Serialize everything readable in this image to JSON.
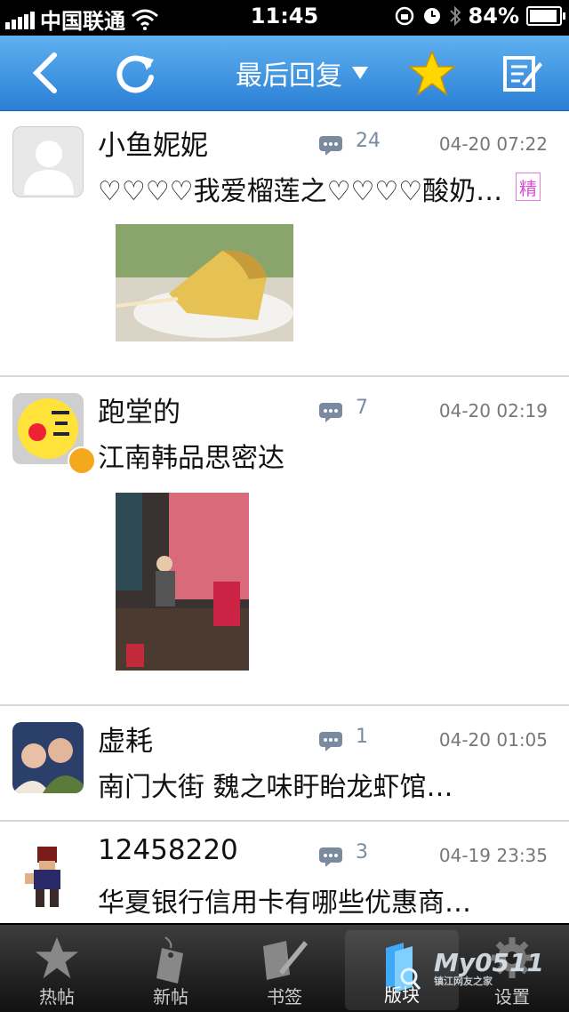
{
  "status": {
    "carrier": "中国联通",
    "time": "11:45",
    "battery": "84%",
    "battery_level": 0.84
  },
  "nav": {
    "back_icon": "back-arrow-icon",
    "refresh_icon": "refresh-icon",
    "title": "最后回复",
    "dropdown_icon": "triangle-down-icon",
    "favorite_icon": "star-icon",
    "compose_icon": "compose-icon"
  },
  "posts": [
    {
      "username": "小鱼妮妮",
      "replies": "24",
      "date": "04-20 07:22",
      "subject": "♡♡♡♡我爱榴莲之♡♡♡♡酸奶…",
      "badge": "精"
    },
    {
      "username": "跑堂的",
      "replies": "7",
      "date": "04-20 02:19",
      "subject": "江南韩品思密达"
    },
    {
      "username": "虚耗",
      "replies": "1",
      "date": "04-20 01:05",
      "subject": "南门大街 魏之味盱眙龙虾馆…"
    },
    {
      "username": "12458220",
      "replies": "3",
      "date": "04-19 23:35",
      "subject": "华夏银行信用卡有哪些优惠商…"
    }
  ],
  "tabs": [
    {
      "label": "热帖",
      "icon": "star-icon"
    },
    {
      "label": "新帖",
      "icon": "tag-icon"
    },
    {
      "label": "书签",
      "icon": "bookmark-icon"
    },
    {
      "label": "版块",
      "icon": "board-icon"
    },
    {
      "label": "设置",
      "icon": "gear-icon"
    }
  ],
  "watermark": {
    "logo": "My0511",
    "sub": "镇江网友之家"
  },
  "colors": {
    "nav_blue": "#2a7fd5",
    "tab_dark": "#222222",
    "badge_pink": "#d94fd4"
  }
}
